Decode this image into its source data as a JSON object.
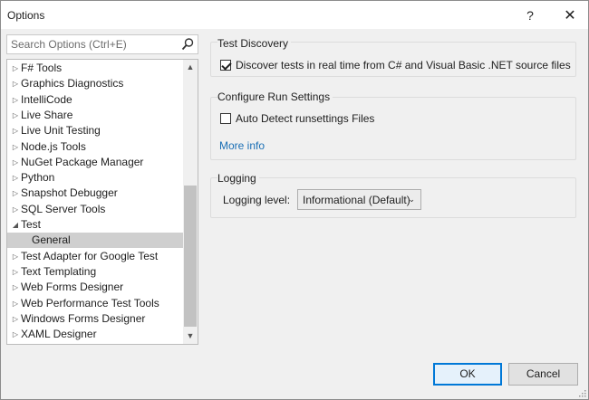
{
  "window": {
    "title": "Options",
    "help_glyph": "?",
    "close_glyph": "✕"
  },
  "search": {
    "placeholder": "Search Options (Ctrl+E)",
    "value": ""
  },
  "tree": {
    "items": [
      {
        "label": "F# Tools",
        "arrow": "▷"
      },
      {
        "label": "Graphics Diagnostics",
        "arrow": "▷"
      },
      {
        "label": "IntelliCode",
        "arrow": "▷"
      },
      {
        "label": "Live Share",
        "arrow": "▷"
      },
      {
        "label": "Live Unit Testing",
        "arrow": "▷"
      },
      {
        "label": "Node.js Tools",
        "arrow": "▷"
      },
      {
        "label": "NuGet Package Manager",
        "arrow": "▷"
      },
      {
        "label": "Python",
        "arrow": "▷"
      },
      {
        "label": "Snapshot Debugger",
        "arrow": "▷"
      },
      {
        "label": "SQL Server Tools",
        "arrow": "▷"
      },
      {
        "label": "Test",
        "arrow": "◢"
      },
      {
        "label": "General",
        "arrow": ""
      },
      {
        "label": "Test Adapter for Google Test",
        "arrow": "▷"
      },
      {
        "label": "Text Templating",
        "arrow": "▷"
      },
      {
        "label": "Web Forms Designer",
        "arrow": "▷"
      },
      {
        "label": "Web Performance Test Tools",
        "arrow": "▷"
      },
      {
        "label": "Windows Forms Designer",
        "arrow": "▷"
      },
      {
        "label": "XAML Designer",
        "arrow": "▷"
      }
    ],
    "scroll_up_glyph": "▲",
    "scroll_down_glyph": "▼"
  },
  "test_discovery": {
    "title": "Test Discovery",
    "discover_label": "Discover tests in real time from C# and Visual Basic .NET source files",
    "discover_checked": true
  },
  "run_settings": {
    "title": "Configure Run Settings",
    "auto_detect_label": "Auto Detect runsettings Files",
    "auto_detect_checked": false,
    "more_info": "More info"
  },
  "logging": {
    "title": "Logging",
    "level_label": "Logging level:",
    "level_value": "Informational (Default)",
    "chevron_glyph": "⌄"
  },
  "buttons": {
    "ok": "OK",
    "cancel": "Cancel"
  }
}
